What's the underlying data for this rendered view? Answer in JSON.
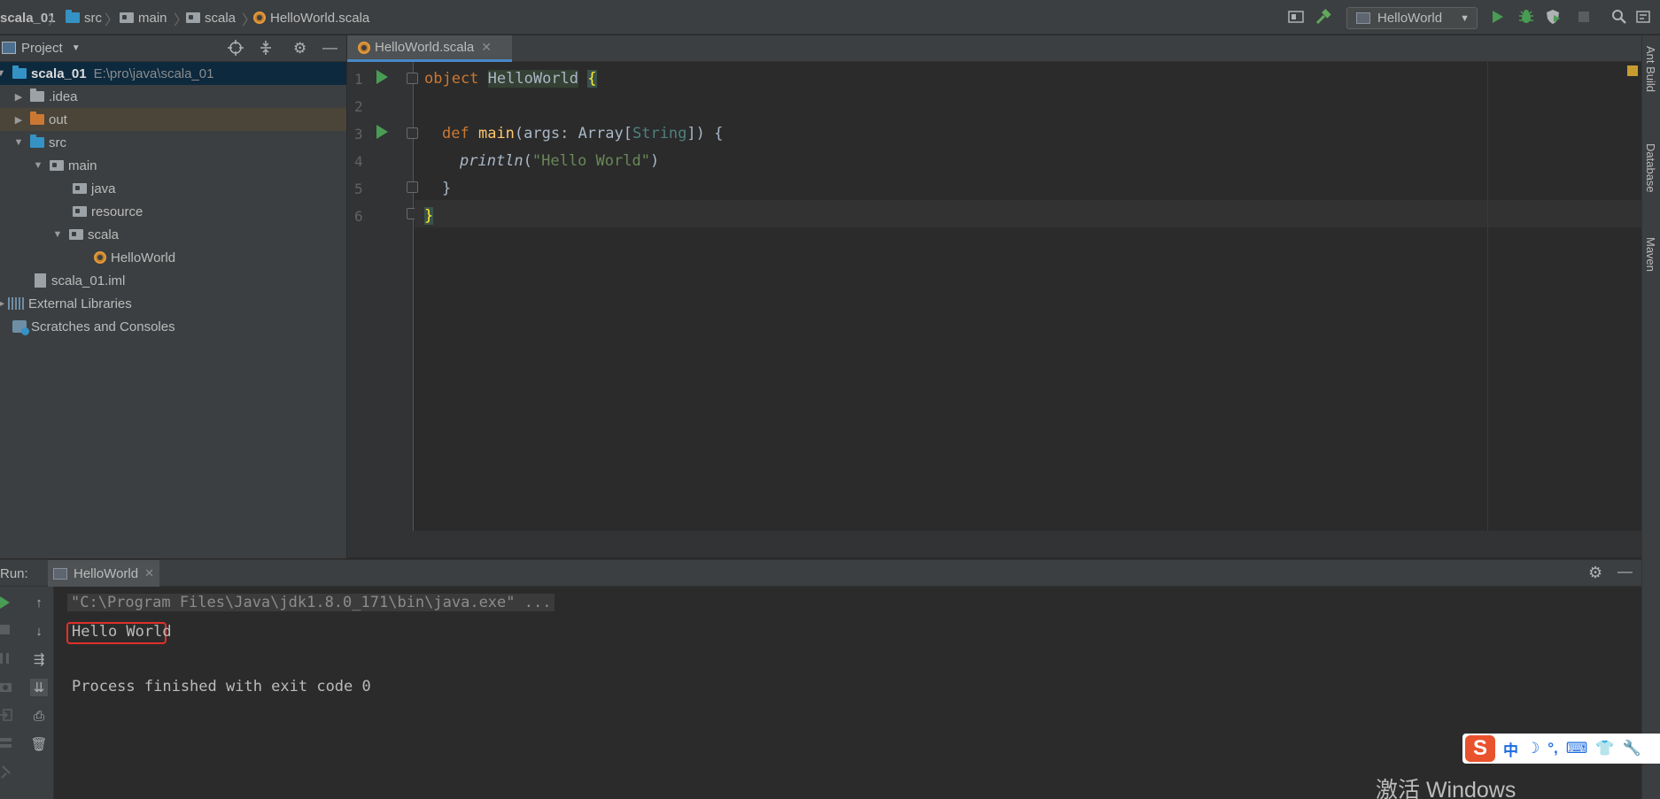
{
  "breadcrumb": {
    "project": "scala_01",
    "items": [
      "src",
      "main",
      "scala",
      "HelloWorld.scala"
    ]
  },
  "toolbar": {
    "run_config": "HelloWorld",
    "icons": [
      "build-hammer-icon",
      "run-icon",
      "debug-icon",
      "coverage-icon",
      "stop-icon",
      "search-icon",
      "structure-icon"
    ]
  },
  "project_panel": {
    "title": "Project",
    "tree": [
      {
        "label": "scala_01",
        "hint": "E:\\pro\\java\\scala_01",
        "toggle": "▼",
        "icon": "module-folder"
      },
      {
        "label": ".idea",
        "toggle": "▶",
        "icon": "folder"
      },
      {
        "label": "out",
        "toggle": "▶",
        "icon": "folder-excluded"
      },
      {
        "label": "src",
        "toggle": "▼",
        "icon": "folder"
      },
      {
        "label": "main",
        "toggle": "▼",
        "icon": "package"
      },
      {
        "label": "java",
        "icon": "package"
      },
      {
        "label": "resource",
        "icon": "package"
      },
      {
        "label": "scala",
        "toggle": "▼",
        "icon": "package"
      },
      {
        "label": "HelloWorld",
        "icon": "scala-object"
      },
      {
        "label": "scala_01.iml",
        "icon": "iml-file"
      },
      {
        "label": "External Libraries",
        "icon": "libraries"
      },
      {
        "label": "Scratches and Consoles",
        "icon": "scratches"
      }
    ]
  },
  "editor": {
    "tab_label": "HelloWorld.scala",
    "line_numbers": [
      "1",
      "2",
      "3",
      "4",
      "5",
      "6"
    ],
    "code": {
      "l1_kw": "object",
      "l1_name": "HelloWorld",
      "l1_brace": "{",
      "l3_kw": "def",
      "l3_fn": "main",
      "l3_args": "(args: Array[",
      "l3_type": "String",
      "l3_end": "]) {",
      "l4_fn": "println",
      "l4_open": "(",
      "l4_str": "\"Hello World\"",
      "l4_close": ")",
      "l5": "}",
      "l6": "}"
    }
  },
  "right_stripe": [
    "Ant Build",
    "Database",
    "Maven"
  ],
  "run_panel": {
    "label": "Run:",
    "tab_label": "HelloWorld",
    "console": {
      "command": "\"C:\\Program Files\\Java\\jdk1.8.0_171\\bin\\java.exe\" ...",
      "output": "Hello World",
      "finish": "Process finished with exit code 0"
    }
  },
  "ime": {
    "logo": "S",
    "items": [
      "中",
      "☽",
      "°,",
      "⌨",
      "👕",
      "🔧"
    ]
  },
  "watermark": "激活 Windows",
  "colors": {
    "background": "#2b2b2b",
    "panel": "#3c3f41",
    "keyword": "#cc7832",
    "function": "#ffc66d",
    "string": "#6a8759",
    "highlight_box": "#e0302a"
  }
}
